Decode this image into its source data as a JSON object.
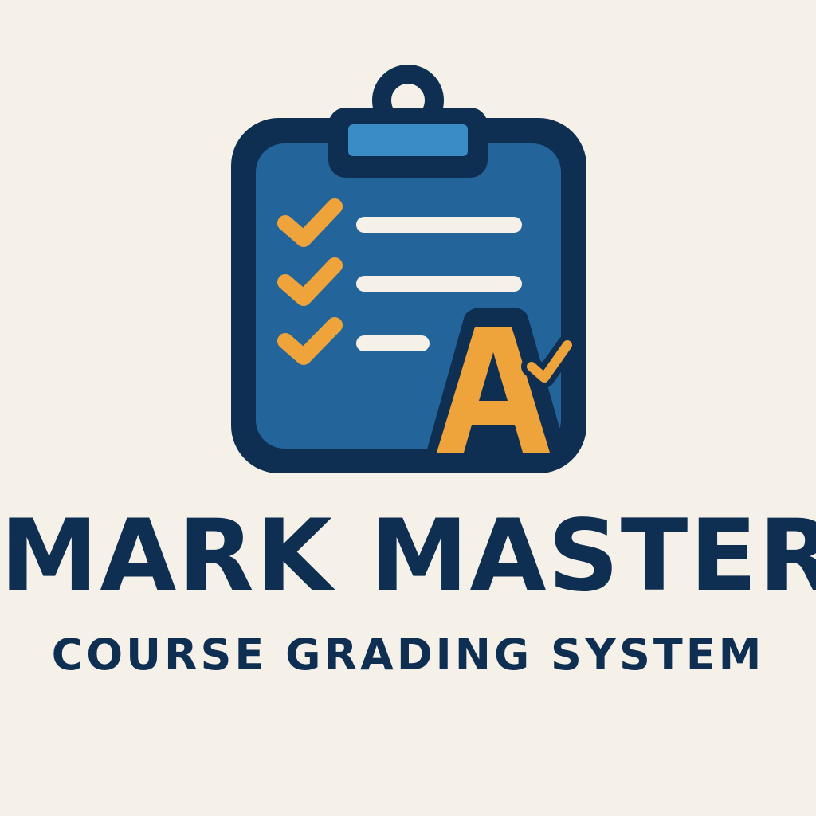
{
  "brand": {
    "name": "MARK MASTER",
    "tagline": "COURSE GRADING SYSTEM",
    "logo_grade_letter": "A"
  },
  "colors": {
    "background": "#f6f1e8",
    "navy": "#0e2f52",
    "board_blue": "#23659a",
    "clip_blue": "#3a8cc6",
    "accent_orange": "#eea43a",
    "line_cream": "#f6f1e8"
  },
  "icons": [
    "clipboard-icon",
    "checkmark-icon",
    "grade-a-icon"
  ]
}
